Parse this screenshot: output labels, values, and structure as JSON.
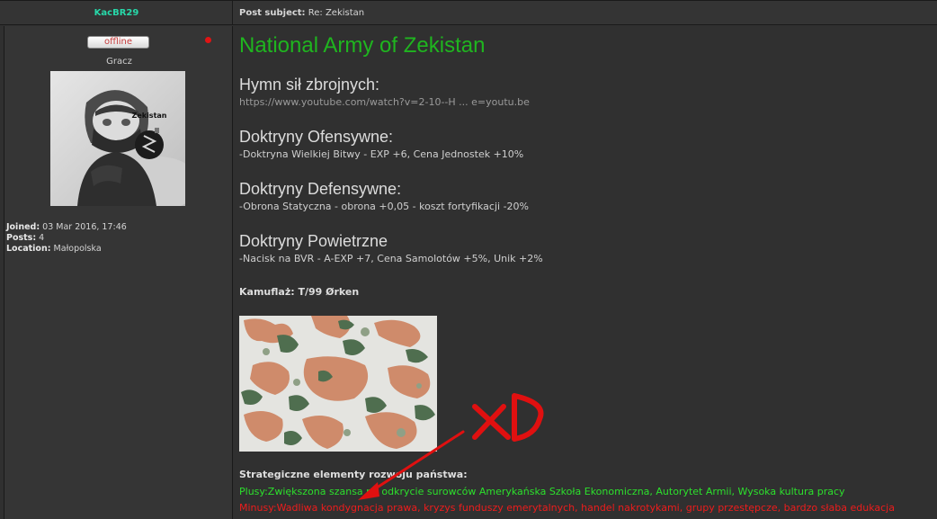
{
  "header": {
    "author": "KacBR29",
    "subject_label": "Post subject:",
    "subject_value": "Re: Zekistan"
  },
  "profile": {
    "status": "offline",
    "rank": "Gracz",
    "avatar_text": "Zekistan",
    "joined_label": "Joined:",
    "joined_value": "03 Mar 2016, 17:46",
    "posts_label": "Posts:",
    "posts_value": "4",
    "location_label": "Location:",
    "location_value": "Małopolska"
  },
  "post": {
    "title": "National Army of Zekistan",
    "anthem_heading": "Hymn sił zbrojnych:",
    "anthem_url": "https://www.youtube.com/watch?v=2-10--H ... e=youtu.be",
    "offensive_heading": "Doktryny Ofensywne:",
    "offensive_text": "-Doktryna Wielkiej Bitwy - EXP +6, Cena Jednostek +10%",
    "defensive_heading": "Doktryny Defensywne:",
    "defensive_text": "-Obrona Statyczna - obrona +0,05 - koszt fortyfikacji -20%",
    "air_heading": "Doktryny Powietrzne",
    "air_text": "-Nacisk na BVR - A-EXP +7, Cena Samolotów +5%, Unik +2%",
    "camo_label": "Kamuflaż: T/99 Ørken",
    "strategic_heading": "Strategiczne elementy rozwoju państwa:",
    "plus_text": "Plusy:Zwiększona szansa na odkrycie surowców Amerykańska Szkoła Ekonomiczna, Autorytet Armii, Wysoka kultura pracy",
    "minus_text": "Minusy:Wadliwa kondygnacja prawa, kryzys funduszy emerytalnych, handel nakrotykami, grupy przestępcze, bardzo słaba edukacja"
  },
  "annotation": {
    "scribble": "xD"
  },
  "colors": {
    "author": "#27d8a9",
    "title": "#1fb51f",
    "plus": "#2ce02c",
    "minus": "#ee1c1c",
    "annotation": "#e01010"
  }
}
